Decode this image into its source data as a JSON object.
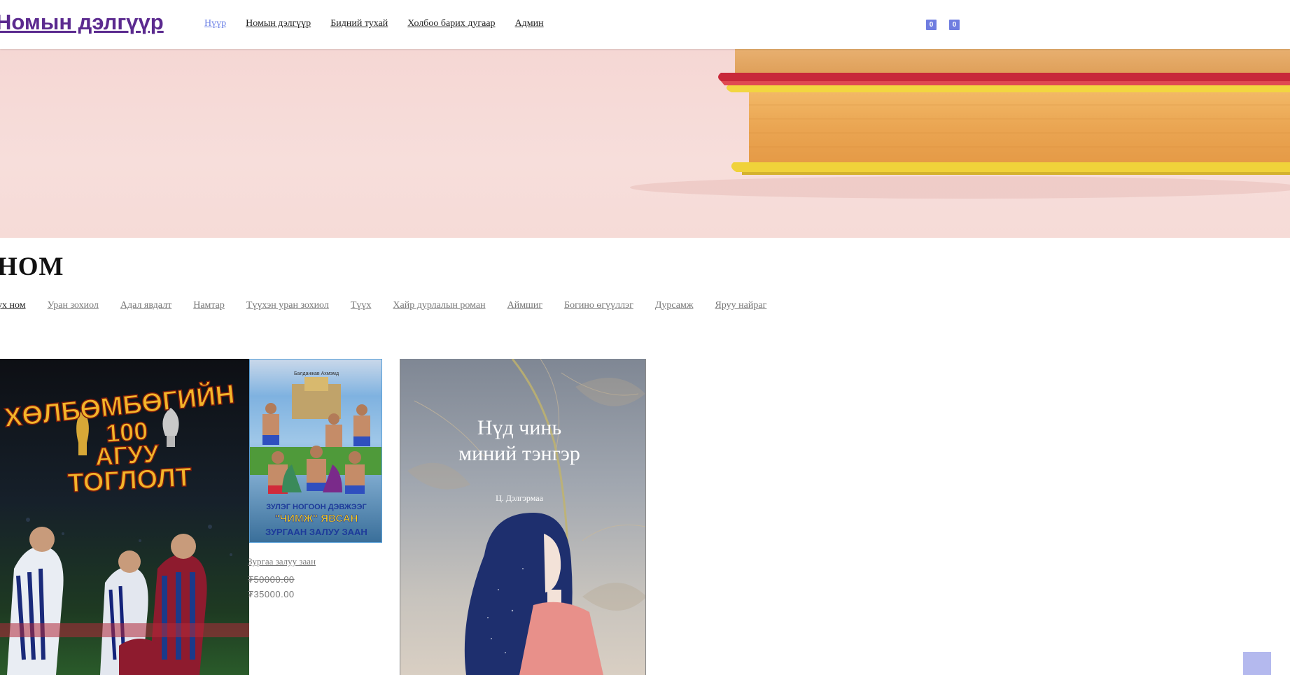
{
  "header": {
    "logo": "Номын дэлгүүр",
    "nav": [
      "Нүүр",
      "Номын дэлгүүр",
      "Бидний тухай",
      "Холбоо барих дугаар",
      "Админ"
    ],
    "badges": [
      "0",
      "0"
    ]
  },
  "section": {
    "title": "НОМ",
    "categories": [
      "ух ном",
      "Уран зохиол",
      "Адал явдалт",
      "Намтар",
      "Түүхэн уран зохиол",
      "Түүх",
      "Хайр дурлалын роман",
      "Аймшиг",
      "Богино өгүүллэг",
      "Дурсамж",
      "Яруу найраг"
    ]
  },
  "products": [
    {
      "cover_lines": [
        "ХӨЛБӨМБӨГИЙН",
        "100",
        "АГУУ",
        "ТОГЛОЛТ"
      ]
    },
    {
      "cover_top": "Балданжав Ахмэмд",
      "cover_lines": [
        "ЗУЛЭГ НОГООН ДЭВЖЭЭГ",
        "\"ЧИМЖ\" ЯВСАН",
        "ЗУРГААН ЗАЛУУ ЗААН"
      ],
      "title": "Зургаа залуу заан",
      "old_price": "₮50000.00",
      "new_price": "₮35000.00"
    },
    {
      "cover_lines": [
        "Нүд чинь",
        "миний тэнгэр"
      ],
      "author": "Ц. Дэлгэрмаа"
    }
  ],
  "colors": {
    "logo": "#5b2a8f",
    "nav_active": "#6f83e6",
    "badge": "#6f7de0",
    "hero_bg": "#f5d7d4",
    "scroll_top": "#b4b9ee"
  }
}
